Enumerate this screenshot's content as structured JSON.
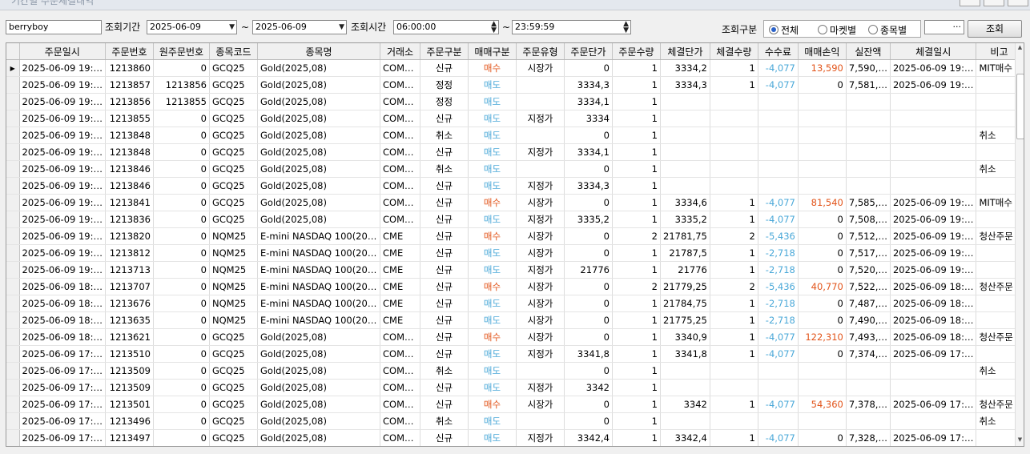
{
  "window": {
    "title": "기간별 주문체결내역"
  },
  "filters": {
    "account": "berryboy",
    "period_label": "조회기간",
    "date_from": "2025-06-09",
    "tilde": "~",
    "date_to": "2025-06-09",
    "time_label": "조회시간",
    "time_from": "06:00:00",
    "time_to": "23:59:59",
    "query_type_label": "조회구분",
    "options": [
      "전체",
      "마켓별",
      "종목별"
    ],
    "selected_option": "전체",
    "ellipsis": "···",
    "search_button": "조회"
  },
  "table": {
    "columns": [
      "주문일시",
      "주문번호",
      "원주문번호",
      "종목코드",
      "종목명",
      "거래소",
      "주문구분",
      "매매구분",
      "주문유형",
      "주문단가",
      "주문수량",
      "체결단가",
      "체결수량",
      "수수료",
      "매매손익",
      "실잔액",
      "체결일시",
      "비고"
    ],
    "rows": [
      [
        "2025-06-09 19:…",
        "1213860",
        "0",
        "GCQ25",
        "Gold(2025,08)",
        "COM…",
        "신규",
        "매수",
        "시장가",
        "0",
        "1",
        "3334,2",
        "1",
        "-4,077",
        "13,590",
        "7,590,…",
        "2025-06-09 19:…",
        "MIT매수"
      ],
      [
        "2025-06-09 19:…",
        "1213857",
        "1213856",
        "GCQ25",
        "Gold(2025,08)",
        "COM…",
        "정정",
        "매도",
        "",
        "3334,3",
        "1",
        "3334,3",
        "1",
        "-4,077",
        "0",
        "7,581,…",
        "2025-06-09 19:…",
        ""
      ],
      [
        "2025-06-09 19:…",
        "1213856",
        "1213855",
        "GCQ25",
        "Gold(2025,08)",
        "COM…",
        "정정",
        "매도",
        "",
        "3334,1",
        "1",
        "",
        "",
        "",
        "",
        "",
        "",
        ""
      ],
      [
        "2025-06-09 19:…",
        "1213855",
        "0",
        "GCQ25",
        "Gold(2025,08)",
        "COM…",
        "신규",
        "매도",
        "지정가",
        "3334",
        "1",
        "",
        "",
        "",
        "",
        "",
        "",
        ""
      ],
      [
        "2025-06-09 19:…",
        "1213848",
        "0",
        "GCQ25",
        "Gold(2025,08)",
        "COM…",
        "취소",
        "매도",
        "",
        "0",
        "1",
        "",
        "",
        "",
        "",
        "",
        "",
        "취소"
      ],
      [
        "2025-06-09 19:…",
        "1213848",
        "0",
        "GCQ25",
        "Gold(2025,08)",
        "COM…",
        "신규",
        "매도",
        "지정가",
        "3334,1",
        "1",
        "",
        "",
        "",
        "",
        "",
        "",
        ""
      ],
      [
        "2025-06-09 19:…",
        "1213846",
        "0",
        "GCQ25",
        "Gold(2025,08)",
        "COM…",
        "취소",
        "매도",
        "",
        "0",
        "1",
        "",
        "",
        "",
        "",
        "",
        "",
        "취소"
      ],
      [
        "2025-06-09 19:…",
        "1213846",
        "0",
        "GCQ25",
        "Gold(2025,08)",
        "COM…",
        "신규",
        "매도",
        "지정가",
        "3334,3",
        "1",
        "",
        "",
        "",
        "",
        "",
        "",
        ""
      ],
      [
        "2025-06-09 19:…",
        "1213841",
        "0",
        "GCQ25",
        "Gold(2025,08)",
        "COM…",
        "신규",
        "매수",
        "시장가",
        "0",
        "1",
        "3334,6",
        "1",
        "-4,077",
        "81,540",
        "7,585,…",
        "2025-06-09 19:…",
        "MIT매수"
      ],
      [
        "2025-06-09 19:…",
        "1213836",
        "0",
        "GCQ25",
        "Gold(2025,08)",
        "COM…",
        "신규",
        "매도",
        "지정가",
        "3335,2",
        "1",
        "3335,2",
        "1",
        "-4,077",
        "0",
        "7,508,…",
        "2025-06-09 19:…",
        ""
      ],
      [
        "2025-06-09 19:…",
        "1213820",
        "0",
        "NQM25",
        "E-mini NASDAQ 100(20…",
        "CME",
        "신규",
        "매수",
        "시장가",
        "0",
        "2",
        "21781,75",
        "2",
        "-5,436",
        "0",
        "7,512,…",
        "2025-06-09 19:…",
        "청산주문"
      ],
      [
        "2025-06-09 19:…",
        "1213812",
        "0",
        "NQM25",
        "E-mini NASDAQ 100(20…",
        "CME",
        "신규",
        "매도",
        "시장가",
        "0",
        "1",
        "21787,5",
        "1",
        "-2,718",
        "0",
        "7,517,…",
        "2025-06-09 19:…",
        ""
      ],
      [
        "2025-06-09 19:…",
        "1213713",
        "0",
        "NQM25",
        "E-mini NASDAQ 100(20…",
        "CME",
        "신규",
        "매도",
        "지정가",
        "21776",
        "1",
        "21776",
        "1",
        "-2,718",
        "0",
        "7,520,…",
        "2025-06-09 19:…",
        ""
      ],
      [
        "2025-06-09 18:…",
        "1213707",
        "0",
        "NQM25",
        "E-mini NASDAQ 100(20…",
        "CME",
        "신규",
        "매수",
        "시장가",
        "0",
        "2",
        "21779,25",
        "2",
        "-5,436",
        "40,770",
        "7,522,…",
        "2025-06-09 18:…",
        "청산주문"
      ],
      [
        "2025-06-09 18:…",
        "1213676",
        "0",
        "NQM25",
        "E-mini NASDAQ 100(20…",
        "CME",
        "신규",
        "매도",
        "시장가",
        "0",
        "1",
        "21784,75",
        "1",
        "-2,718",
        "0",
        "7,487,…",
        "2025-06-09 18:…",
        ""
      ],
      [
        "2025-06-09 18:…",
        "1213635",
        "0",
        "NQM25",
        "E-mini NASDAQ 100(20…",
        "CME",
        "신규",
        "매도",
        "시장가",
        "0",
        "1",
        "21775,25",
        "1",
        "-2,718",
        "0",
        "7,490,…",
        "2025-06-09 18:…",
        ""
      ],
      [
        "2025-06-09 18:…",
        "1213621",
        "0",
        "GCQ25",
        "Gold(2025,08)",
        "COM…",
        "신규",
        "매수",
        "시장가",
        "0",
        "1",
        "3340,9",
        "1",
        "-4,077",
        "122,310",
        "7,493,…",
        "2025-06-09 18:…",
        "청산주문"
      ],
      [
        "2025-06-09 17:…",
        "1213510",
        "0",
        "GCQ25",
        "Gold(2025,08)",
        "COM…",
        "신규",
        "매도",
        "지정가",
        "3341,8",
        "1",
        "3341,8",
        "1",
        "-4,077",
        "0",
        "7,374,…",
        "2025-06-09 17:…",
        ""
      ],
      [
        "2025-06-09 17:…",
        "1213509",
        "0",
        "GCQ25",
        "Gold(2025,08)",
        "COM…",
        "취소",
        "매도",
        "",
        "0",
        "1",
        "",
        "",
        "",
        "",
        "",
        "",
        "취소"
      ],
      [
        "2025-06-09 17:…",
        "1213509",
        "0",
        "GCQ25",
        "Gold(2025,08)",
        "COM…",
        "신규",
        "매도",
        "지정가",
        "3342",
        "1",
        "",
        "",
        "",
        "",
        "",
        "",
        ""
      ],
      [
        "2025-06-09 17:…",
        "1213501",
        "0",
        "GCQ25",
        "Gold(2025,08)",
        "COM…",
        "신규",
        "매수",
        "시장가",
        "0",
        "1",
        "3342",
        "1",
        "-4,077",
        "54,360",
        "7,378,…",
        "2025-06-09 17:…",
        "청산주문"
      ],
      [
        "2025-06-09 17:…",
        "1213496",
        "0",
        "GCQ25",
        "Gold(2025,08)",
        "COM…",
        "취소",
        "매도",
        "",
        "0",
        "1",
        "",
        "",
        "",
        "",
        "",
        "",
        "취소"
      ],
      [
        "2025-06-09 17:…",
        "1213497",
        "0",
        "GCQ25",
        "Gold(2025,08)",
        "COM…",
        "신규",
        "매도",
        "지정가",
        "3342,4",
        "1",
        "3342,4",
        "1",
        "-4,077",
        "0",
        "7,328,…",
        "2025-06-09 17:…",
        ""
      ]
    ],
    "selected_row": 0,
    "selection_marker": "▶"
  },
  "colors": {
    "buy": "#e2541a",
    "sell": "#4aa8d8",
    "fee": "#4aa8d8",
    "header_bg": "#f0f0f0"
  }
}
